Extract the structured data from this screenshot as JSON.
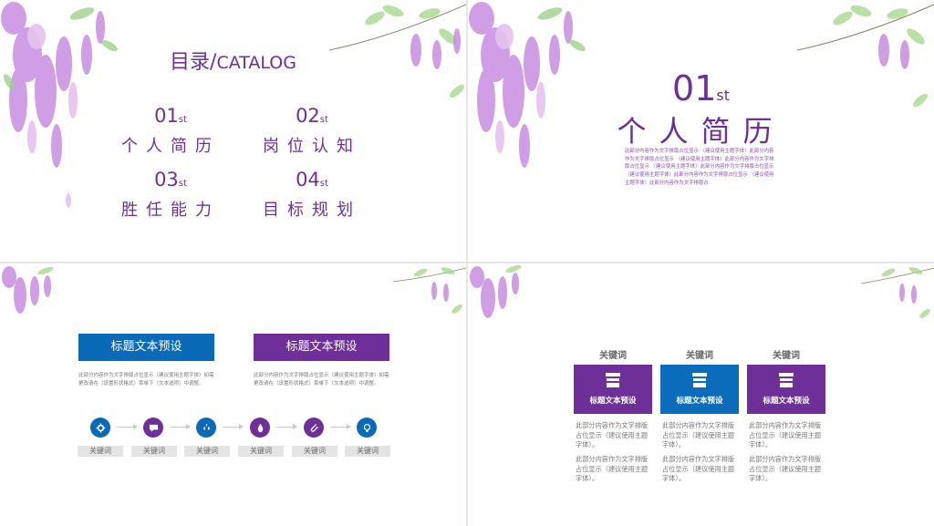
{
  "colors": {
    "purple": "#6d2f9a",
    "blue": "#0a6ab8",
    "box_purple": "#6e2f98",
    "box_blue": "#0b6cbb"
  },
  "slide1": {
    "title_cn": "目录",
    "title_sep": "/",
    "title_en": "CATALOG",
    "items": [
      {
        "num": "01",
        "sup": "st",
        "name": "个人简历"
      },
      {
        "num": "02",
        "sup": "st",
        "name": "岗位认知"
      },
      {
        "num": "03",
        "sup": "st",
        "name": "胜任能力"
      },
      {
        "num": "04",
        "sup": "st",
        "name": "目标规划"
      }
    ]
  },
  "slide2": {
    "num": "01",
    "sup": "st",
    "title": "个人简历",
    "body": "此部分内容作为文字排版占位显示 （建议使用主题字体）此部分内容作为文字排版占位显示 （建议使用主题字体）此部分内容作为文字排版占位显示 （建议使用主题字体）此部分内容作为文字排版占位显示 （建议使用主题字体）此部分内容作为文字排版占位显示 （建议使用主题字体）此部分内容作为文字排版占"
  },
  "slide3": {
    "box_left": "标题文本预设",
    "box_right": "标题文本预设",
    "desc_left": "此部分内容作为文字排版占位显示（建议使用主题字体）如需更改请在（设置形状格式）菜单下（文本选项）中调整。",
    "desc_right": "此部分内容作为文字排版占位显示（建议使用主题字体）如需更改请在（设置形状格式）菜单下（文本选项）中调整。",
    "flow_icons": [
      "gear-icon",
      "chat-icon",
      "drops-icon",
      "drop-icon",
      "paperclip-icon",
      "lightbulb-icon"
    ],
    "keywords": [
      "关键词",
      "关键词",
      "关键词",
      "关键词",
      "关键词",
      "关键词"
    ]
  },
  "slide4": {
    "columns": [
      {
        "keyword": "关键词",
        "label": "标题文本预设",
        "text1": "此部分内容作为文字排版占位显示（建议使用主题字体）。",
        "text2": "此部分内容作为文字排版占位显示（建议使用主题字体）。"
      },
      {
        "keyword": "关键词",
        "label": "标题文本预设",
        "text1": "此部分内容作为文字排版占位显示（建议使用主题字体）。",
        "text2": "此部分内容作为文字排版占位显示（建议使用主题字体）。"
      },
      {
        "keyword": "关键词",
        "label": "标题文本预设",
        "text1": "此部分内容作为文字排版占位显示（建议使用主题字体）。",
        "text2": "此部分内容作为文字排版占位显示（建议使用主题字体）。"
      }
    ]
  }
}
